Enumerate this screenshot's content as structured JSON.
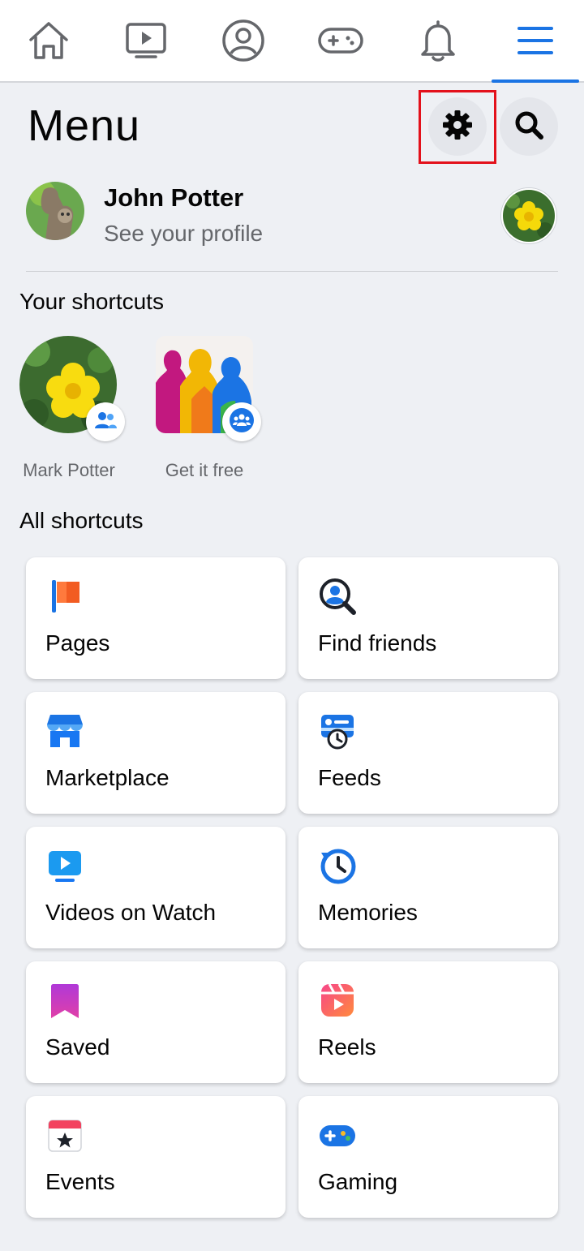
{
  "nav": {
    "tabs": [
      {
        "icon": "home-icon"
      },
      {
        "icon": "video-icon"
      },
      {
        "icon": "profile-icon"
      },
      {
        "icon": "gaming-icon"
      },
      {
        "icon": "bell-icon"
      },
      {
        "icon": "hamburger-menu-icon",
        "active": true
      }
    ],
    "active_color": "#1b74e4"
  },
  "header": {
    "title": "Menu",
    "settings_icon": "gear-icon",
    "search_icon": "search-icon"
  },
  "profile": {
    "name": "John Potter",
    "subtitle": "See your profile"
  },
  "shortcuts": {
    "title": "Your shortcuts",
    "items": [
      {
        "label": "Mark Potter",
        "badge_icon": "friends-icon"
      },
      {
        "label": "Get it free",
        "badge_icon": "group-icon"
      }
    ]
  },
  "all_shortcuts": {
    "title": "All shortcuts",
    "cards": [
      {
        "label": "Pages",
        "icon": "pages-flag-icon"
      },
      {
        "label": "Find friends",
        "icon": "find-friends-icon"
      },
      {
        "label": "Marketplace",
        "icon": "marketplace-icon"
      },
      {
        "label": "Feeds",
        "icon": "feeds-icon"
      },
      {
        "label": "Videos on Watch",
        "icon": "watch-video-icon"
      },
      {
        "label": "Memories",
        "icon": "memories-clock-icon"
      },
      {
        "label": "Saved",
        "icon": "saved-bookmark-icon"
      },
      {
        "label": "Reels",
        "icon": "reels-icon"
      },
      {
        "label": "Events",
        "icon": "events-calendar-icon"
      },
      {
        "label": "Gaming",
        "icon": "gaming-controller-icon"
      }
    ]
  },
  "colors": {
    "background": "#eef0f4",
    "card": "#ffffff",
    "highlight": "#e3111b"
  }
}
